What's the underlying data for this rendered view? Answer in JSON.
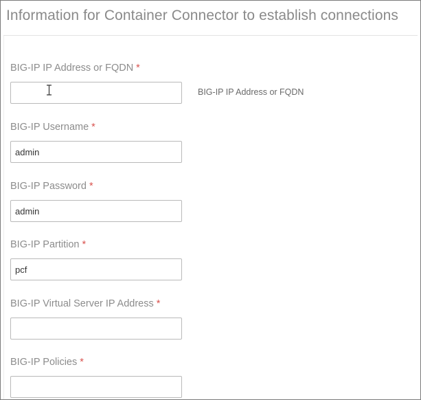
{
  "form": {
    "title": "Information for Container Connector to establish connections",
    "required_marker": "*",
    "fields": [
      {
        "label": "BIG-IP IP Address or FQDN",
        "value": "",
        "help": "BIG-IP IP Address or FQDN"
      },
      {
        "label": "BIG-IP Username",
        "value": "admin"
      },
      {
        "label": "BIG-IP Password",
        "value": "admin"
      },
      {
        "label": "BIG-IP Partition",
        "value": "pcf"
      },
      {
        "label": "BIG-IP Virtual Server IP Address",
        "value": ""
      },
      {
        "label": "BIG-IP Policies",
        "value": ""
      }
    ]
  },
  "colors": {
    "required": "#d9534f",
    "label": "#8c8c8c",
    "border": "#b9b9b9"
  },
  "icons": {
    "cursor": "text-cursor-icon"
  }
}
